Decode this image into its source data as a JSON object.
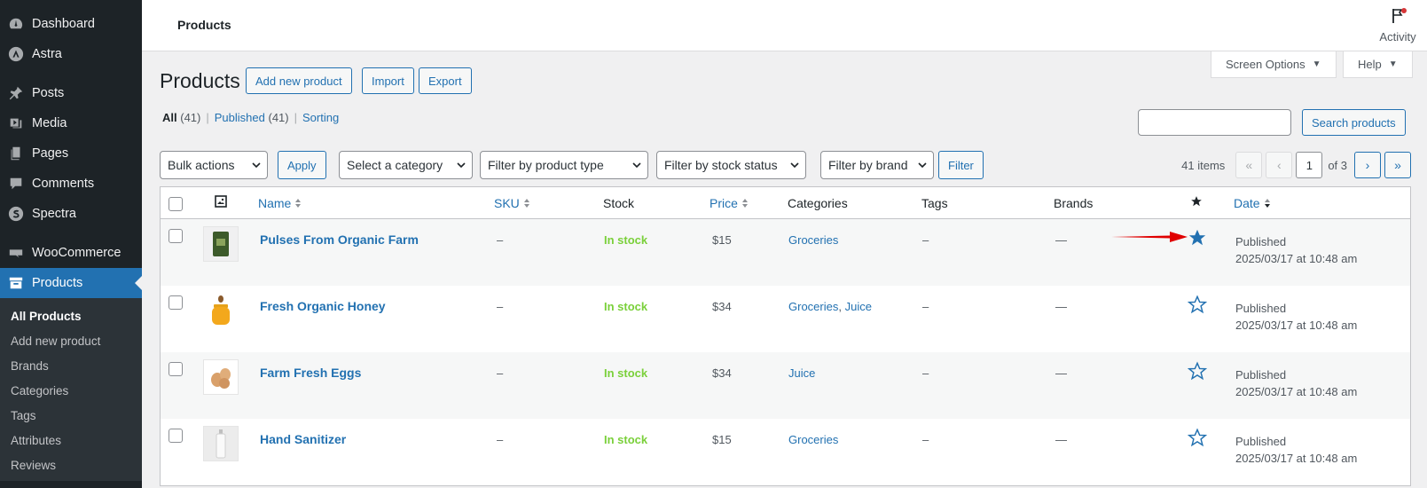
{
  "sidebar": {
    "top_items": [
      {
        "label": "Dashboard",
        "icon": "dashboard-icon"
      },
      {
        "label": "Astra",
        "icon": "astra-icon"
      }
    ],
    "items": [
      {
        "label": "Posts",
        "icon": "pin-icon"
      },
      {
        "label": "Media",
        "icon": "media-icon"
      },
      {
        "label": "Pages",
        "icon": "pages-icon"
      },
      {
        "label": "Comments",
        "icon": "comment-icon"
      },
      {
        "label": "Spectra",
        "icon": "spectra-icon"
      }
    ],
    "woo": {
      "label": "WooCommerce",
      "icon": "woocommerce-icon"
    },
    "active": {
      "label": "Products",
      "icon": "archive-icon"
    },
    "submenu": [
      "All Products",
      "Add new product",
      "Brands",
      "Categories",
      "Tags",
      "Attributes",
      "Reviews"
    ]
  },
  "topbar": {
    "title": "Products",
    "activity_label": "Activity"
  },
  "tabs": {
    "screen_options": "Screen Options",
    "help": "Help"
  },
  "header": {
    "title": "Products",
    "add_new": "Add new product",
    "import": "Import",
    "export": "Export"
  },
  "views": {
    "all": "All",
    "all_count": "(41)",
    "published": "Published",
    "published_count": "(41)",
    "sorting": "Sorting",
    "separator": "|"
  },
  "search": {
    "button": "Search products",
    "value": ""
  },
  "filters": {
    "bulk_actions": "Bulk actions",
    "apply": "Apply",
    "category": "Select a category",
    "product_type": "Filter by product type",
    "stock_status": "Filter by stock status",
    "brand": "Filter by brand",
    "filter": "Filter"
  },
  "pagination": {
    "items": "41 items",
    "first": "«",
    "prev": "‹",
    "current": "1",
    "of": "of 3",
    "next": "›",
    "last": "»"
  },
  "columns": {
    "name": "Name",
    "sku": "SKU",
    "stock": "Stock",
    "price": "Price",
    "categories": "Categories",
    "tags": "Tags",
    "brands": "Brands",
    "date": "Date"
  },
  "rows": [
    {
      "name": "Pulses From Organic Farm",
      "sku": "–",
      "stock": "In stock",
      "price": "$15",
      "categories": [
        "Groceries"
      ],
      "tags": "–",
      "brands": "—",
      "featured": true,
      "status": "Published",
      "date": "2025/03/17 at 10:48 am",
      "thumb": "bag"
    },
    {
      "name": "Fresh Organic Honey",
      "sku": "–",
      "stock": "In stock",
      "price": "$34",
      "categories": [
        "Groceries",
        "Juice"
      ],
      "tags": "–",
      "brands": "—",
      "featured": false,
      "status": "Published",
      "date": "2025/03/17 at 10:48 am",
      "thumb": "honey"
    },
    {
      "name": "Farm Fresh Eggs",
      "sku": "–",
      "stock": "In stock",
      "price": "$34",
      "categories": [
        "Juice"
      ],
      "tags": "–",
      "brands": "—",
      "featured": false,
      "status": "Published",
      "date": "2025/03/17 at 10:48 am",
      "thumb": "eggs"
    },
    {
      "name": "Hand Sanitizer",
      "sku": "–",
      "stock": "In stock",
      "price": "$15",
      "categories": [
        "Groceries"
      ],
      "tags": "–",
      "brands": "—",
      "featured": false,
      "status": "Published",
      "date": "2025/03/17 at 10:48 am",
      "thumb": "bottle"
    }
  ],
  "colors": {
    "accent": "#2271b1",
    "instock": "#7ad03a",
    "sidebar": "#1d2327",
    "arrow": "#e00000"
  }
}
